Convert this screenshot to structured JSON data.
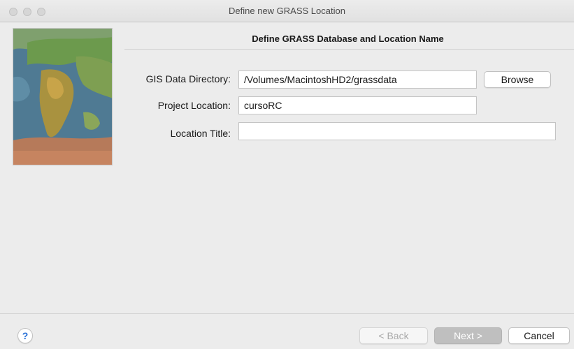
{
  "window": {
    "title": "Define new GRASS Location"
  },
  "heading": "Define GRASS Database and Location Name",
  "form": {
    "gis_dir_label": "GIS Data Directory:",
    "gis_dir_value": "/Volumes/MacintoshHD2/grassdata",
    "project_location_label": "Project Location:",
    "project_location_value": "cursoRC",
    "location_title_label": "Location Title:",
    "location_title_value": ""
  },
  "buttons": {
    "browse": "Browse",
    "back": "< Back",
    "next": "Next >",
    "cancel": "Cancel",
    "help": "?"
  },
  "icons": {
    "help": "question-mark-icon",
    "sidebar_image": "world-map-image"
  }
}
